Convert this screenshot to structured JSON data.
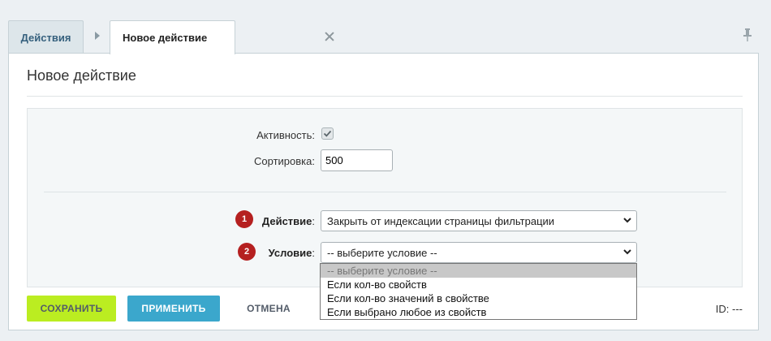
{
  "tabs": {
    "parent_label": "Действия",
    "active_label": "Новое действие"
  },
  "page": {
    "title": "Новое действие"
  },
  "form": {
    "active_label": "Активность:",
    "active_checked": true,
    "sort_label": "Сортировка:",
    "sort_value": "500",
    "action_badge": "1",
    "action_label": "Действие",
    "action_colon": ":",
    "action_value": "Закрыть от индексации страницы фильтрации",
    "condition_badge": "2",
    "condition_label": "Условие",
    "condition_colon": ":",
    "condition_value": "-- выберите условие --"
  },
  "condition_options": [
    "-- выберите условие --",
    "Если кол-во свойств",
    "Если кол-во значений в свойстве",
    "Если выбрано любое из свойств"
  ],
  "footer": {
    "save_label": "СОХРАНИТЬ",
    "apply_label": "ПРИМЕНИТЬ",
    "cancel_label": "ОТМЕНА",
    "id_label": "ID: ---"
  },
  "colors": {
    "save_button": "#bbed21",
    "apply_button": "#3ba7cc",
    "badge": "#b52020"
  }
}
